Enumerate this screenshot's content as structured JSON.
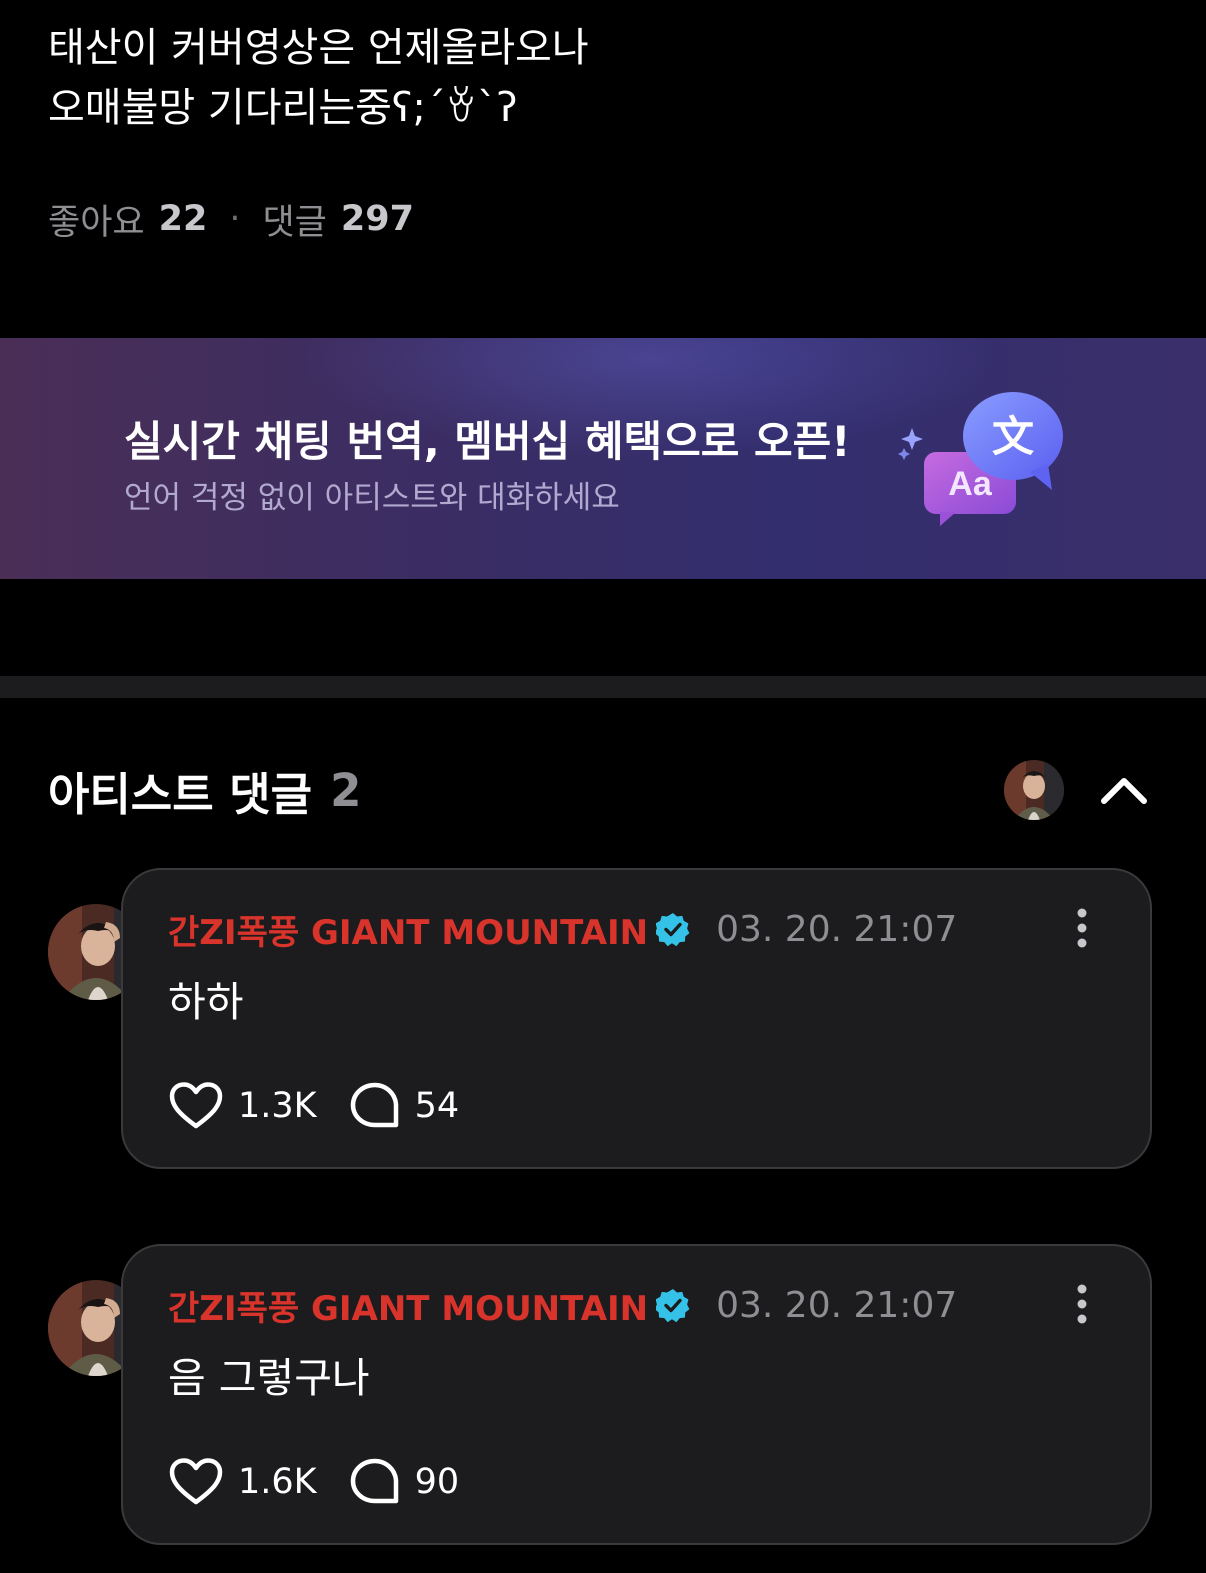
{
  "post": {
    "text": "태산이 커버영상은 언제올라오나\n오매불망 기다리는중ʕ;´ꈊ`ʔ",
    "likes_label": "좋아요",
    "likes_count": "22",
    "separator": "·",
    "comments_label": "댓글",
    "comments_count": "297"
  },
  "banner": {
    "title": "실시간 채팅 번역, 멤버십 혜택으로 오픈!",
    "subtitle": "언어 걱정 없이 아티스트와 대화하세요",
    "icon_text_latin": "Aa",
    "icon_text_cjk": "文",
    "icon_name": "translate-chat-icon"
  },
  "artist_section": {
    "title": "아티스트 댓글",
    "count": "2",
    "collapse_icon": "chevron-up-icon"
  },
  "comments": [
    {
      "author": "간ZI폭풍 GIANT MOUNTAIN",
      "time": "03. 20. 21:07",
      "body": "하하",
      "likes": "1.3K",
      "replies": "54"
    },
    {
      "author": "간ZI폭풍 GIANT MOUNTAIN",
      "time": "03. 20. 21:07",
      "body": "음 그렇구나",
      "likes": "1.6K",
      "replies": "90"
    }
  ],
  "colors": {
    "author": "#d9342b",
    "verified": "#35c2e8",
    "card_bg": "#1c1c1e",
    "card_border": "#3a3a3c",
    "muted": "#8e8e93"
  }
}
